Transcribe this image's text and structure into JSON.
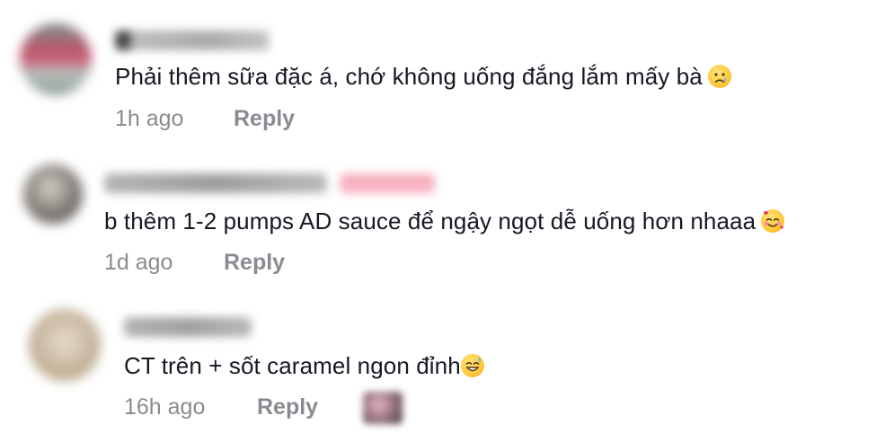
{
  "comments": [
    {
      "text": "Phải thêm sữa đặc á, chớ không uống đắng lắm mấy bà",
      "emoji": "crying-face-emoji",
      "time": "1h ago",
      "reply_label": "Reply"
    },
    {
      "text": "b thêm 1-2 pumps AD sauce để ngậy ngọt dễ uống hơn nhaaa",
      "emoji": "smiling-face-with-hearts-emoji",
      "time": "1d ago",
      "reply_label": "Reply"
    },
    {
      "text": "CT trên + sốt caramel ngon đỉnh",
      "emoji": "grinning-face-with-sweat-emoji",
      "time": "16h ago",
      "reply_label": "Reply"
    }
  ],
  "colors": {
    "text": "#161823",
    "meta": "#8a8b91",
    "creator_badge": "#fe2c55"
  }
}
